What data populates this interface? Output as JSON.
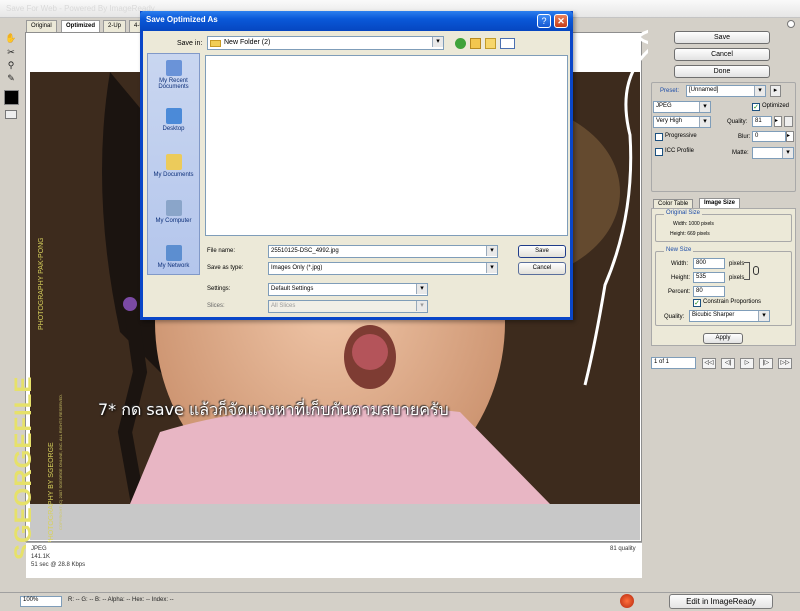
{
  "window": {
    "title": "Save For Web - Powered By ImageReady"
  },
  "view_tabs": [
    "Original",
    "Optimized",
    "2-Up",
    "4-Up"
  ],
  "watermark": {
    "big": "SGEORGEFILE",
    "line1": "PHOTOGRAPHY   PAK-PONG",
    "line2": "PHOTOGRAPHY BY SGEORGE",
    "line3": "COPYRIGHT (C) 2007 SGEORGE ONLINE, INC. ALL RIGHTS RESERVED."
  },
  "canvas_status": {
    "format": "JPEG",
    "size": "141.1K",
    "time": "51 sec @ 28.8 Kbps",
    "quality": "81 quality"
  },
  "annotation": "7* กด save แล้วก็จัดแจงหาที่เก็บกันตามสบายครับ",
  "bottom_bar": {
    "zoom": "100%",
    "info": "R: --   G: --   B: --   Alpha: --   Hex: --   Index: --",
    "edit_button": "Edit in ImageReady"
  },
  "right_panel": {
    "save": "Save",
    "cancel": "Cancel",
    "done": "Done",
    "preset_label": "Preset:",
    "preset_value": "[Unnamed]",
    "format": "JPEG",
    "optimized": "Optimized",
    "quality_preset": "Very High",
    "quality_label": "Quality:",
    "quality_value": "81",
    "progressive": "Progressive",
    "blur_label": "Blur:",
    "blur_value": "0",
    "icc_profile": "ICC Profile",
    "matte_label": "Matte:",
    "tab_color_table": "Color Table",
    "tab_image_size": "Image Size",
    "original_size_title": "Original Size",
    "orig_width": "Width: 1000 pixels",
    "orig_height": "Height: 669 pixels",
    "new_size_title": "New Size",
    "width_label": "Width:",
    "width_value": "800",
    "height_label": "Height:",
    "height_value": "535",
    "pixels": "pixels",
    "percent_label": "Percent:",
    "percent_value": "80",
    "constrain": "Constrain Proportions",
    "resample_label": "Quality:",
    "resample_value": "Bicubic Sharper",
    "apply": "Apply",
    "frame_counter": "1 of 1"
  },
  "dialog": {
    "title": "Save Optimized As",
    "save_in_label": "Save in:",
    "save_in_value": "New Folder (2)",
    "places": [
      "My Recent Documents",
      "Desktop",
      "My Documents",
      "My Computer",
      "My Network"
    ],
    "file_name_label": "File name:",
    "file_name_value": "25510125-DSC_4992.jpg",
    "save_as_label": "Save as type:",
    "save_as_value": "Images Only (*.jpg)",
    "settings_label": "Settings:",
    "settings_value": "Default Settings",
    "slices_label": "Slices:",
    "slices_value": "All Slices",
    "save_button": "Save",
    "cancel_button": "Cancel"
  }
}
